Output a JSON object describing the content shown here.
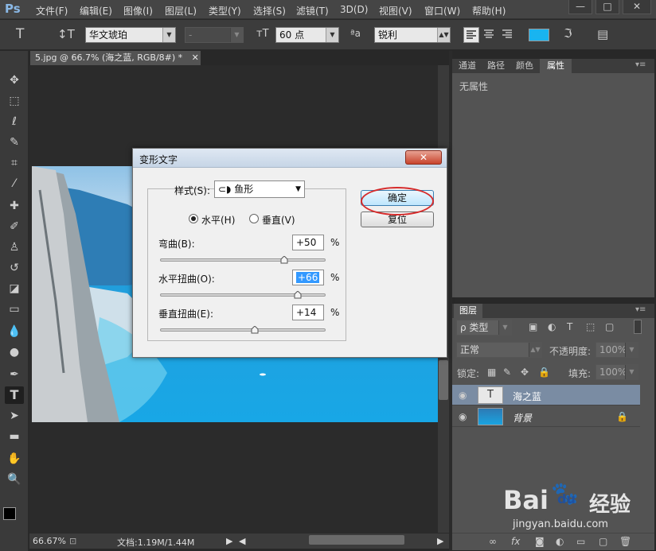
{
  "app": {
    "logo": "Ps",
    "menu": [
      "文件(F)",
      "编辑(E)",
      "图像(I)",
      "图层(L)",
      "类型(Y)",
      "选择(S)",
      "滤镜(T)",
      "3D(D)",
      "视图(V)",
      "窗口(W)",
      "帮助(H)"
    ],
    "window_buttons": [
      "—",
      "□",
      "✕"
    ]
  },
  "options_bar": {
    "font_family": "华文琥珀",
    "font_style": "-",
    "font_size": "60 点",
    "aa_label": "ªa",
    "antialias": "锐利",
    "color_swatch": "#19b4f0"
  },
  "document": {
    "tab_title": "5.jpg @ 66.7% (海之蓝, RGB/8#) *",
    "zoom": "66.67%",
    "doc_info": "文档:1.19M/1.44M"
  },
  "properties_panel": {
    "tabs": [
      "通道",
      "路径",
      "颜色",
      "属性"
    ],
    "active_tab": "属性",
    "body_text": "无属性"
  },
  "layers_panel": {
    "title": "图层",
    "filter_label": "ρ 类型",
    "blend_mode": "正常",
    "opacity_label": "不透明度:",
    "opacity_value": "100%",
    "lock_label": "锁定:",
    "fill_label": "填充:",
    "fill_value": "100%",
    "layers": [
      {
        "name": "海之蓝",
        "type": "text",
        "selected": true
      },
      {
        "name": "背景",
        "type": "image",
        "selected": false
      }
    ]
  },
  "warp_dialog": {
    "title": "变形文字",
    "close_label": "✕",
    "style_label": "样式(S):",
    "style_value": "鱼形",
    "horizontal_label": "水平(H)",
    "vertical_label": "垂直(V)",
    "orientation": "horizontal",
    "bend_label": "弯曲(B):",
    "bend_value": "+50",
    "bend_percent": 50,
    "hdist_label": "水平扭曲(O):",
    "hdist_value": "+66",
    "hdist_percent": 66,
    "vdist_label": "垂直扭曲(E):",
    "vdist_value": "+14",
    "vdist_percent": 14,
    "percent_sign": "%",
    "ok_label": "确定",
    "reset_label": "复位"
  },
  "watermark": {
    "brand": "Bai",
    "brand2": "du",
    "brand3": "经验",
    "url": "jingyan.baidu.com"
  },
  "colors": {
    "accent": "#19b4f0",
    "highlight_circle": "#d62b2b"
  }
}
